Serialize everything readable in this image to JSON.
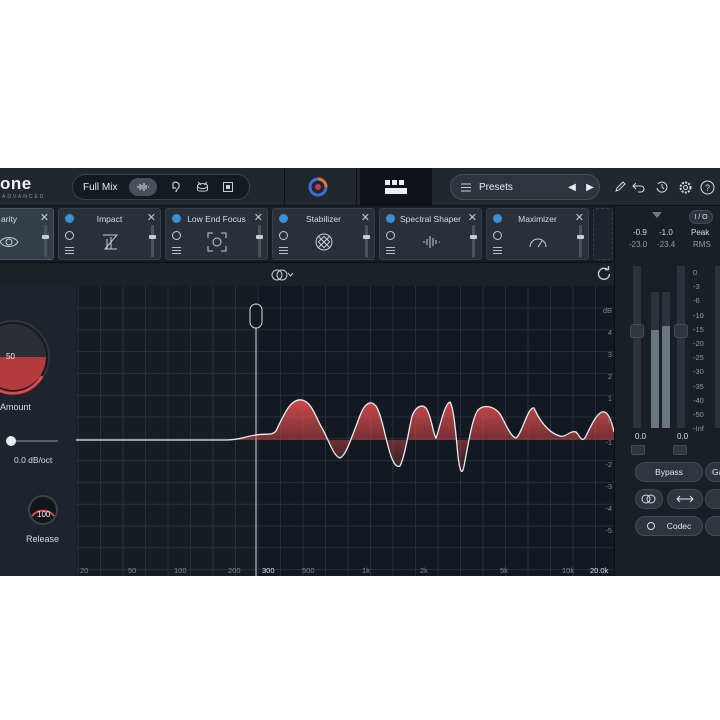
{
  "app": {
    "logo_text": "one",
    "logo_sub": "ADVANCED"
  },
  "topbar": {
    "mix_label": "Full Mix",
    "presets_label": "Presets",
    "icons": [
      "waveform-icon",
      "voice-icon",
      "drum-icon",
      "box-icon",
      "pen-icon",
      "undo-icon",
      "history-icon",
      "gear-icon",
      "help-icon"
    ]
  },
  "modules": [
    {
      "name": "arity",
      "active": true
    },
    {
      "name": "Impact",
      "active": false
    },
    {
      "name": "Low End Focus",
      "active": false
    },
    {
      "name": "Stabilizer",
      "active": false
    },
    {
      "name": "Spectral Shaper",
      "active": false
    },
    {
      "name": "Maximizer",
      "active": false
    }
  ],
  "left_panel": {
    "amount_value": "50",
    "amount_label": "Amount",
    "slope_value": "0.0 dB/oct",
    "release_value": "100",
    "release_label": "Release"
  },
  "graph": {
    "x_ticks": [
      "20",
      "50",
      "100",
      "200",
      "300",
      "500",
      "1k",
      "2k",
      "5k",
      "10k",
      "20.0k"
    ],
    "y_ticks": [
      "dB",
      "4",
      "3",
      "2",
      "1",
      "0",
      "-1",
      "-2",
      "-3",
      "-4",
      "-5"
    ],
    "crossover_hz": 300,
    "curve_color": "#e8edf1",
    "fill_color": "#d94a4a"
  },
  "meters": {
    "io_label": "I / O",
    "peak_label": "Peak",
    "rms_label": "RMS",
    "peak_left": "-0.9",
    "peak_right": "-1.0",
    "rms_left": "-23.0",
    "rms_right": "-23.4",
    "left_bottom": "0.0",
    "right_bottom": "0.0",
    "scale": [
      "0",
      "-3",
      "-6",
      "-10",
      "-15",
      "-20",
      "-25",
      "-30",
      "-35",
      "-40",
      "-50",
      "-Inf"
    ],
    "input_level_left": 0.72,
    "input_level_right": 0.75,
    "bypass_label": "Bypass",
    "gain_label": "Ga",
    "codec_label": "Codec"
  }
}
